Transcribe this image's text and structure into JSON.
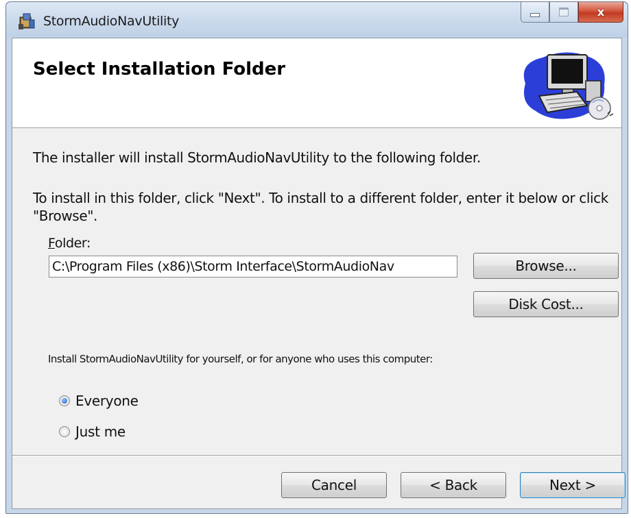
{
  "window": {
    "title": "StormAudioNavUtility",
    "icon": "installer-package-icon",
    "controls": {
      "minimize": "minimize-icon",
      "maximize": "maximize-icon",
      "close_glyph": "x"
    }
  },
  "banner": {
    "title": "Select Installation Folder",
    "art": "computer-with-cd-icon"
  },
  "body": {
    "intro": "The installer will install StormAudioNavUtility to the following folder.",
    "instructions": "To install in this folder, click \"Next\". To install to a different folder, enter it below or click \"Browse\".",
    "folder_label_accel": "F",
    "folder_label_rest": "older:",
    "folder_value": "C:\\Program Files (x86)\\Storm Interface\\StormAudioNav",
    "browse_label": "Browse...",
    "disk_cost_label": "Disk Cost...",
    "install_for_text": "Install StormAudioNavUtility for yourself, or for anyone who uses this computer:",
    "options": [
      {
        "label": "Everyone",
        "selected": true
      },
      {
        "label": "Just me",
        "selected": false
      }
    ]
  },
  "footer": {
    "cancel_label": "Cancel",
    "back_label": "< Back",
    "next_label": "Next >"
  },
  "colors": {
    "accent": "#3c7fb1",
    "close_button": "#c23b22",
    "frame": "#c7d7ea"
  }
}
